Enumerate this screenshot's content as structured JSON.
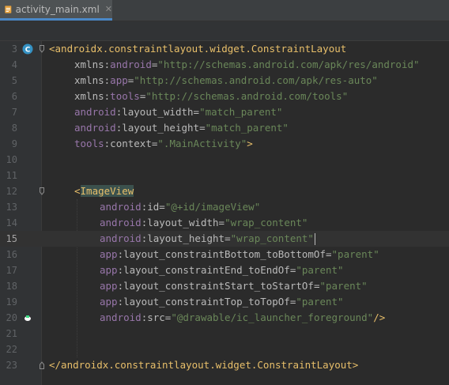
{
  "tab": {
    "filename": "activity_main.xml",
    "close": "✕"
  },
  "colors": {
    "tag": "#e8bf6a",
    "namespace": "#9876aa",
    "attribute": "#bababa",
    "value": "#6a8759",
    "background": "#2b2b2b"
  },
  "lines": [
    {
      "n": "3",
      "s": "<androidx.constraintlayout.widget.ConstraintLayout"
    },
    {
      "n": "4",
      "p": "xmlns",
      "c": ":",
      "a": "android",
      "e": "=",
      "v": "\"http://schemas.android.com/apk/res/android\""
    },
    {
      "n": "5",
      "p": "xmlns",
      "c": ":",
      "a": "app",
      "e": "=",
      "v": "\"http://schemas.android.com/apk/res-auto\""
    },
    {
      "n": "6",
      "p": "xmlns",
      "c": ":",
      "a": "tools",
      "e": "=",
      "v": "\"http://schemas.android.com/tools\""
    },
    {
      "n": "7",
      "p": "android",
      "c": ":",
      "a": "layout_width",
      "e": "=",
      "v": "\"match_parent\""
    },
    {
      "n": "8",
      "p": "android",
      "c": ":",
      "a": "layout_height",
      "e": "=",
      "v": "\"match_parent\""
    },
    {
      "n": "9",
      "p": "tools",
      "c": ":",
      "a": "context",
      "e": "=",
      "v": "\".MainActivity\"",
      "end": ">"
    },
    {
      "n": "10"
    },
    {
      "n": "11"
    },
    {
      "n": "12",
      "lt": "<",
      "t": "ImageView"
    },
    {
      "n": "13",
      "p": "android",
      "c": ":",
      "a": "id",
      "e": "=",
      "v": "\"@+id/imageView\""
    },
    {
      "n": "14",
      "p": "android",
      "c": ":",
      "a": "layout_width",
      "e": "=",
      "v": "\"wrap_content\""
    },
    {
      "n": "15",
      "p": "android",
      "c": ":",
      "a": "layout_height",
      "e": "=",
      "v": "\"wrap_content\""
    },
    {
      "n": "16",
      "p": "app",
      "c": ":",
      "a": "layout_constraintBottom_toBottomOf",
      "e": "=",
      "v": "\"parent\""
    },
    {
      "n": "17",
      "p": "app",
      "c": ":",
      "a": "layout_constraintEnd_toEndOf",
      "e": "=",
      "v": "\"parent\""
    },
    {
      "n": "18",
      "p": "app",
      "c": ":",
      "a": "layout_constraintStart_toStartOf",
      "e": "=",
      "v": "\"parent\""
    },
    {
      "n": "19",
      "p": "app",
      "c": ":",
      "a": "layout_constraintTop_toTopOf",
      "e": "=",
      "v": "\"parent\""
    },
    {
      "n": "20",
      "p": "android",
      "c": ":",
      "a": "src",
      "e": "=",
      "v": "\"@drawable/ic_launcher_foreground\"",
      "end": "/>"
    },
    {
      "n": "21"
    },
    {
      "n": "22"
    },
    {
      "n": "23",
      "s": "</androidx.constraintlayout.widget.ConstraintLayout>"
    }
  ]
}
